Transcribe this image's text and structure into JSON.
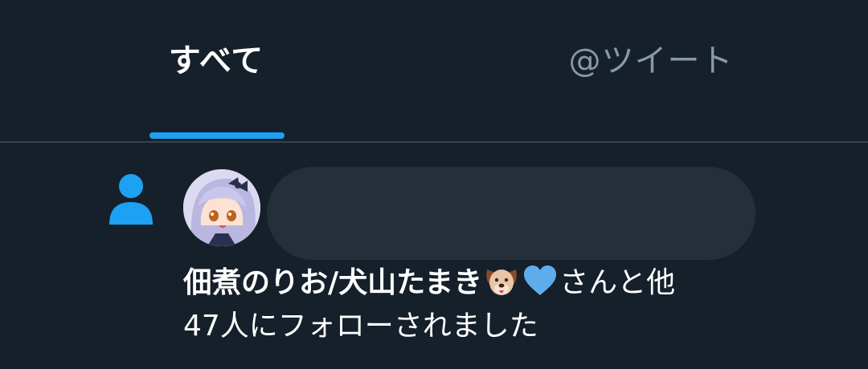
{
  "tabs": [
    {
      "label": "すべて",
      "active": true
    },
    {
      "label": "@ツイート",
      "active": false
    }
  ],
  "notification": {
    "icon": "person-icon",
    "user_name": "佃煮のりお/犬山たまき",
    "name_emojis": [
      "dog-face-emoji",
      "blue-heart-emoji"
    ],
    "suffix_line1": "さんと他",
    "line2": "47人にフォローされました"
  },
  "colors": {
    "background": "#15202b",
    "accent": "#1da1f2",
    "inactive_tab": "#8899a6",
    "divider": "#38444d"
  }
}
